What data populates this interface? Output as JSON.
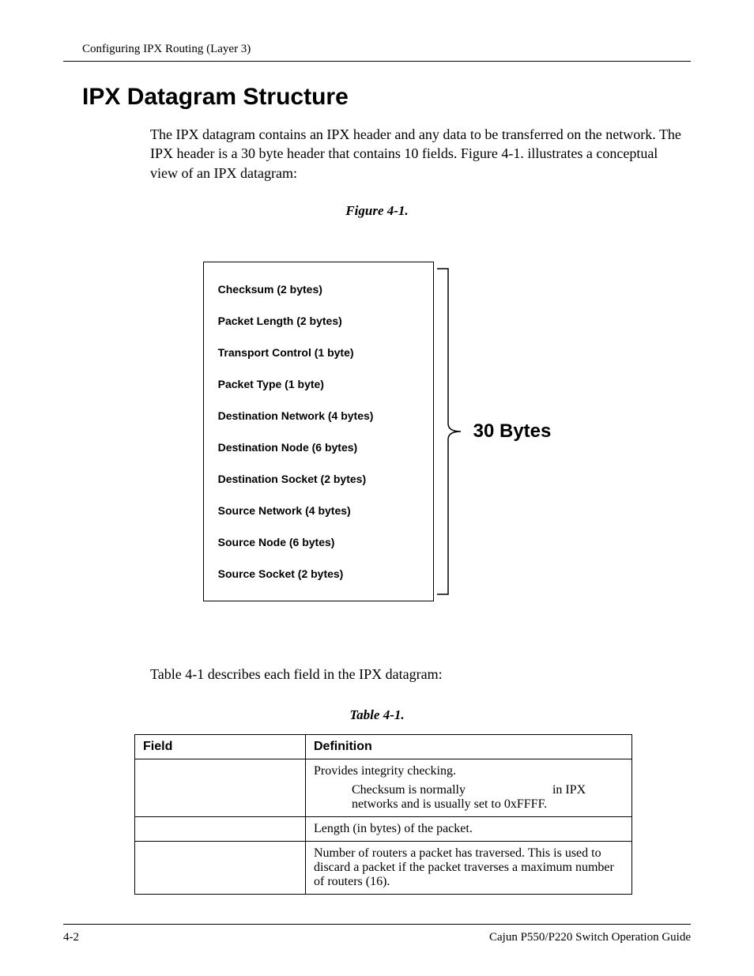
{
  "header": {
    "running_head": "Configuring IPX Routing (Layer 3)"
  },
  "section": {
    "title": "IPX Datagram Structure",
    "intro": "The IPX datagram contains an IPX header and any data to be transferred on the network. The IPX header is a 30 byte header that contains 10 fields. Figure 4-1. illustrates a conceptual view of an IPX datagram:"
  },
  "figure": {
    "caption": "Figure 4-1.",
    "fields": [
      "Checksum (2 bytes)",
      "Packet Length (2 bytes)",
      "Transport Control (1 byte)",
      "Packet Type (1 byte)",
      "Destination Network (4 bytes)",
      "Destination Node (6 bytes)",
      "Destination Socket (2 bytes)",
      "Source Network (4 bytes)",
      "Source Node (6 bytes)",
      "Source Socket (2 bytes)"
    ],
    "brace_label": "30 Bytes"
  },
  "table_intro": "Table 4-1 describes each field in the IPX datagram:",
  "table": {
    "caption": "Table 4-1.",
    "head_field": "Field",
    "head_def": "Definition",
    "rows": [
      {
        "field": "",
        "def_line1": "Provides integrity checking.",
        "def_note_a": "Checksum is normally",
        "def_note_b": "in IPX networks and is usually set to 0xFFFF."
      },
      {
        "field": "",
        "def": "Length (in bytes) of the packet."
      },
      {
        "field": "",
        "def": "Number of routers a packet has traversed. This is used to discard a packet if the packet traverses a maximum number of routers (16)."
      }
    ]
  },
  "footer": {
    "left": "4-2",
    "right": "Cajun P550/P220 Switch Operation Guide"
  }
}
